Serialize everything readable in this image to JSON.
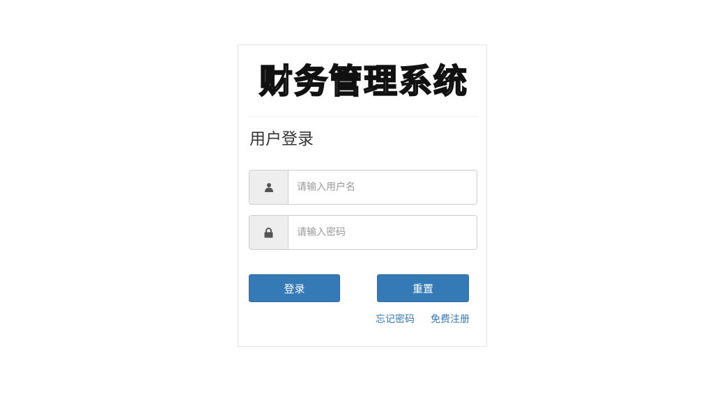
{
  "header": {
    "logo_text": "财务管理系统",
    "subtitle": "用户登录"
  },
  "form": {
    "username": {
      "icon": "user-icon",
      "placeholder": "请输入用户名",
      "value": ""
    },
    "password": {
      "icon": "lock-icon",
      "placeholder": "请输入密码",
      "value": ""
    },
    "login_label": "登录",
    "reset_label": "重置"
  },
  "links": {
    "forgot_password": "忘记密码",
    "register": "免费注册"
  },
  "colors": {
    "primary": "#337ab7",
    "addon_bg": "#eeeeee",
    "border": "#cccccc",
    "icon": "#555555"
  }
}
